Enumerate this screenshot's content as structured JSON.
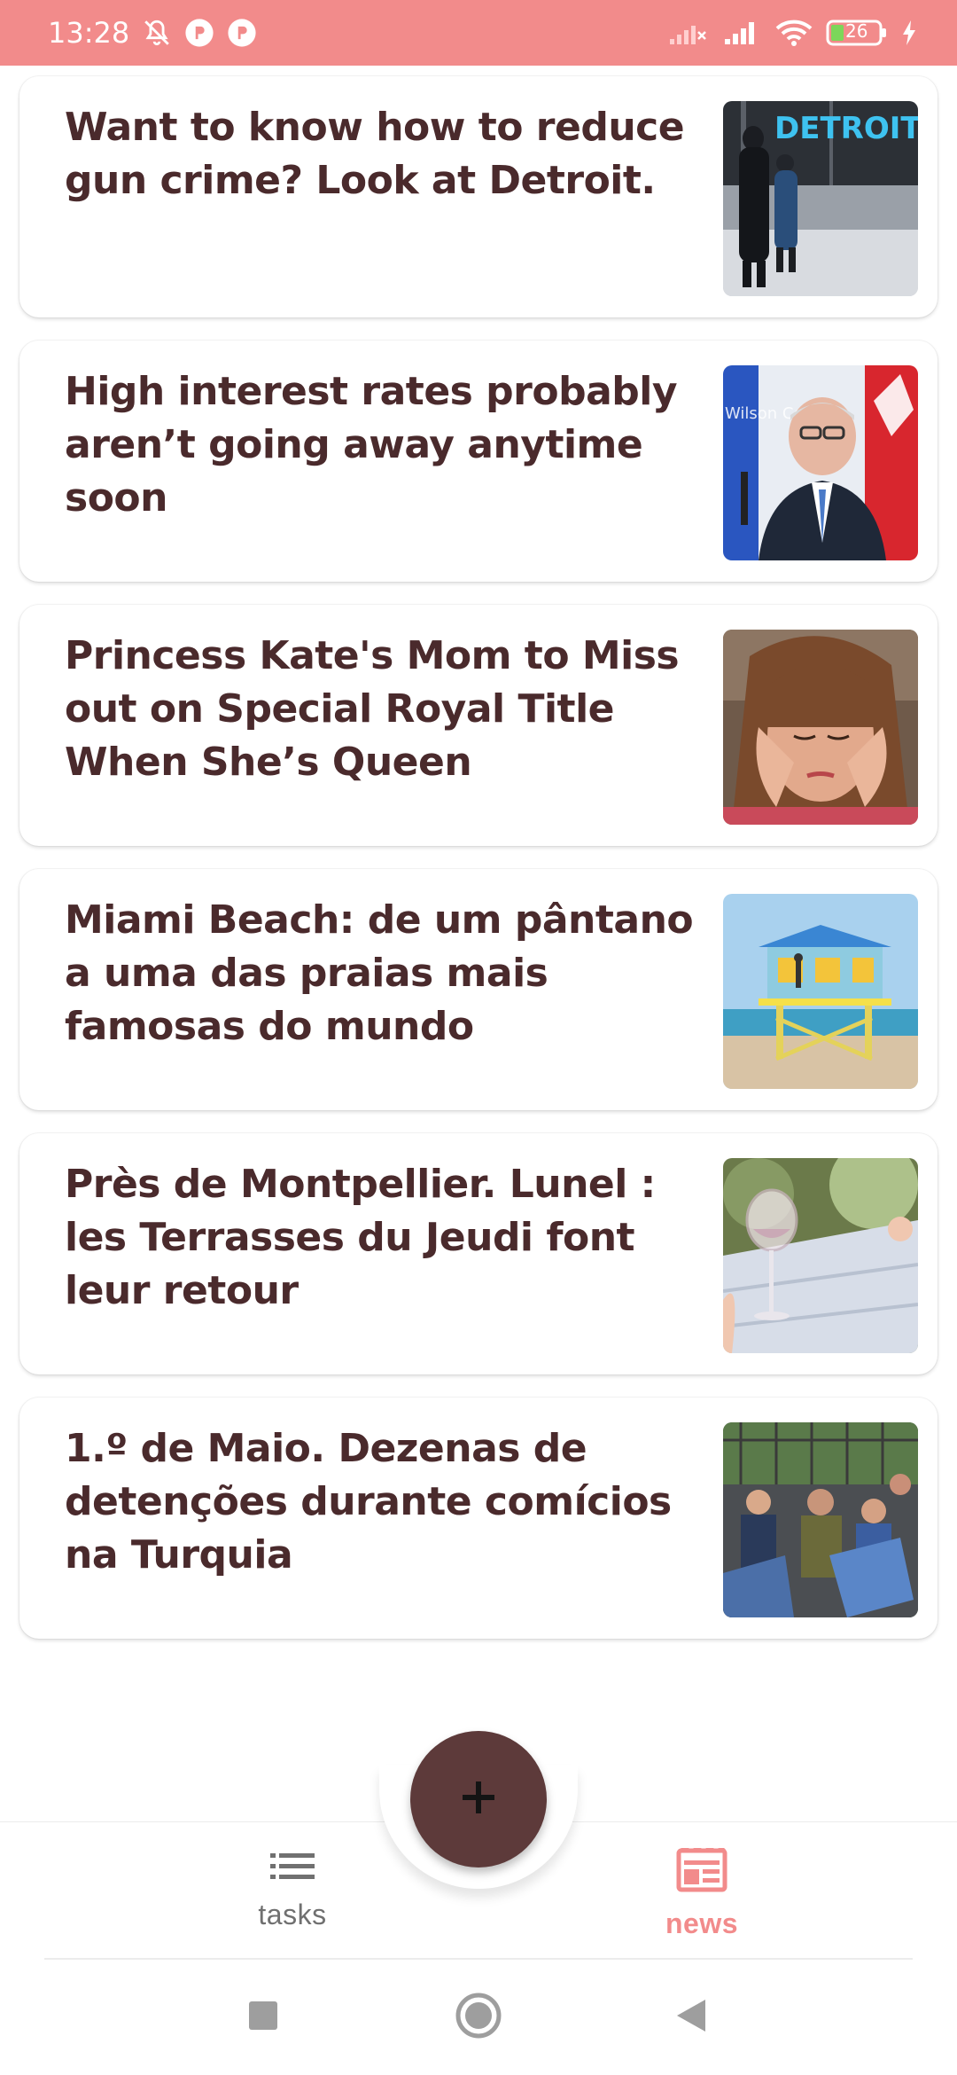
{
  "status_bar": {
    "time": "13:28",
    "battery": "26",
    "icons": [
      "mute-icon",
      "app-notification-icon",
      "app-notification-icon",
      "no-signal-icon",
      "signal-icon",
      "wifi-icon",
      "battery-icon",
      "charging-icon"
    ]
  },
  "news": [
    {
      "title": "Want to know how to reduce gun crime? Look at Detroit.",
      "thumb_text": "DETROIT"
    },
    {
      "title": "High interest rates probably aren’t going away anytime soon",
      "thumb_text": "Wilson Center"
    },
    {
      "title": "Princess Kate's Mom to Miss out on Special Royal Title When She’s Queen"
    },
    {
      "title": "Miami Beach: de um pântano a uma das praias mais famosas do mundo"
    },
    {
      "title": "Près de Montpellier. Lunel : les Terrasses du Jeudi font leur retour"
    },
    {
      "title": "1.º de Maio. Dezenas de detenções durante comícios na Turquia"
    }
  ],
  "bottom_nav": {
    "tasks_label": "tasks",
    "news_label": "news",
    "active": "news",
    "accent": "#f28b8b",
    "fab_icon": "plus-icon",
    "fab_color": "#5d3a3a"
  },
  "colors": {
    "status_bar": "#f28b8b",
    "title_text": "#4a2a2c"
  }
}
